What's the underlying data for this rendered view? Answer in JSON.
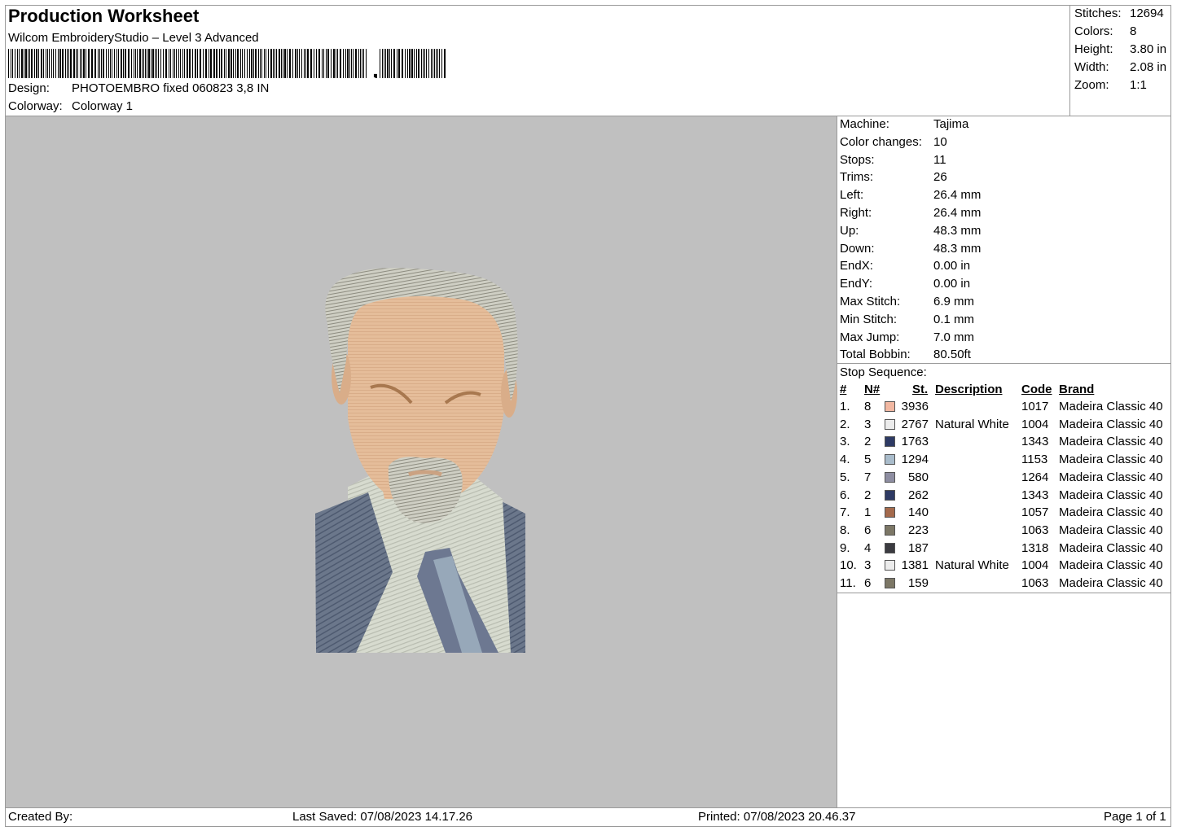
{
  "header": {
    "title": "Production Worksheet",
    "software": "Wilcom EmbroideryStudio – Level 3 Advanced",
    "design_label": "Design:",
    "design_value": "PHOTOEMBRO fixed 060823 3,8 IN",
    "colorway_label": "Colorway:",
    "colorway_value": "Colorway 1"
  },
  "summary": {
    "stitches_label": "Stitches:",
    "stitches_value": "12694",
    "colors_label": "Colors:",
    "colors_value": "8",
    "height_label": "Height:",
    "height_value": "3.80 in",
    "width_label": "Width:",
    "width_value": "2.08 in",
    "zoom_label": "Zoom:",
    "zoom_value": "1:1"
  },
  "machine": {
    "items": [
      {
        "label": "Machine:",
        "value": "Tajima"
      },
      {
        "label": "Color changes:",
        "value": "10"
      },
      {
        "label": "Stops:",
        "value": "11"
      },
      {
        "label": "Trims:",
        "value": "26"
      },
      {
        "label": "Left:",
        "value": "26.4 mm"
      },
      {
        "label": "Right:",
        "value": "26.4 mm"
      },
      {
        "label": "Up:",
        "value": "48.3 mm"
      },
      {
        "label": "Down:",
        "value": "48.3 mm"
      },
      {
        "label": "EndX:",
        "value": "0.00 in"
      },
      {
        "label": "EndY:",
        "value": "0.00 in"
      },
      {
        "label": "Max Stitch:",
        "value": "6.9 mm"
      },
      {
        "label": "Min Stitch:",
        "value": "0.1 mm"
      },
      {
        "label": "Max Jump:",
        "value": "7.0 mm"
      },
      {
        "label": "Total Bobbin:",
        "value": "80.50ft"
      }
    ]
  },
  "stop_sequence": {
    "title": "Stop Sequence:",
    "headers": {
      "idx": "#",
      "needle": "N#",
      "stitches": "St.",
      "description": "Description",
      "code": "Code",
      "brand": "Brand"
    },
    "rows": [
      {
        "idx": "1.",
        "needle": "8",
        "color": "#f2b8a2",
        "stitches": "3936",
        "description": "",
        "code": "1017",
        "brand": "Madeira Classic 40"
      },
      {
        "idx": "2.",
        "needle": "3",
        "color": "#ececec",
        "stitches": "2767",
        "description": "Natural White",
        "code": "1004",
        "brand": "Madeira Classic 40"
      },
      {
        "idx": "3.",
        "needle": "2",
        "color": "#2e3a64",
        "stitches": "1763",
        "description": "",
        "code": "1343",
        "brand": "Madeira Classic 40"
      },
      {
        "idx": "4.",
        "needle": "5",
        "color": "#a9bccb",
        "stitches": "1294",
        "description": "",
        "code": "1153",
        "brand": "Madeira Classic 40"
      },
      {
        "idx": "5.",
        "needle": "7",
        "color": "#8e8ea2",
        "stitches": "580",
        "description": "",
        "code": "1264",
        "brand": "Madeira Classic 40"
      },
      {
        "idx": "6.",
        "needle": "2",
        "color": "#2e3a64",
        "stitches": "262",
        "description": "",
        "code": "1343",
        "brand": "Madeira Classic 40"
      },
      {
        "idx": "7.",
        "needle": "1",
        "color": "#a46a4c",
        "stitches": "140",
        "description": "",
        "code": "1057",
        "brand": "Madeira Classic 40"
      },
      {
        "idx": "8.",
        "needle": "6",
        "color": "#7c7766",
        "stitches": "223",
        "description": "",
        "code": "1063",
        "brand": "Madeira Classic 40"
      },
      {
        "idx": "9.",
        "needle": "4",
        "color": "#3b3b40",
        "stitches": "187",
        "description": "",
        "code": "1318",
        "brand": "Madeira Classic 40"
      },
      {
        "idx": "10.",
        "needle": "3",
        "color": "#ececec",
        "stitches": "1381",
        "description": "Natural White",
        "code": "1004",
        "brand": "Madeira Classic 40"
      },
      {
        "idx": "11.",
        "needle": "6",
        "color": "#7c7766",
        "stitches": "159",
        "description": "",
        "code": "1063",
        "brand": "Madeira Classic 40"
      }
    ]
  },
  "footer": {
    "created_by": "Created By:",
    "last_saved": "Last Saved: 07/08/2023 14.17.26",
    "printed": "Printed: 07/08/2023 20.46.37",
    "page": "Page 1 of 1"
  },
  "colors": {
    "canvas_bg": "#c0c0c0",
    "skin": "#e8bb97",
    "hair": "#c8c8bd",
    "suit": "#5d6b80",
    "shirt": "#d5d8cc"
  }
}
